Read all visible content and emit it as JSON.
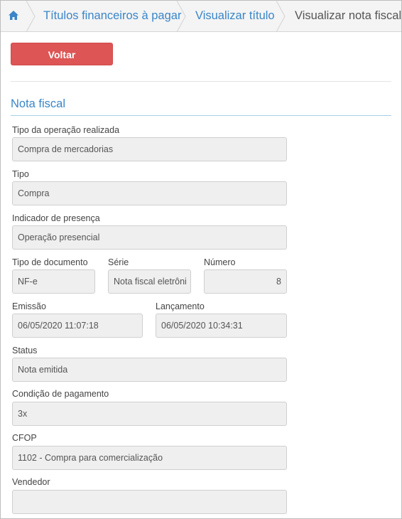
{
  "breadcrumb": {
    "items": [
      {
        "label": "Títulos financeiros à pagar"
      },
      {
        "label": "Visualizar título"
      },
      {
        "label": "Visualizar nota fiscal"
      }
    ]
  },
  "actions": {
    "back_label": "Voltar"
  },
  "section": {
    "title": "Nota fiscal"
  },
  "fields": {
    "tipo_operacao": {
      "label": "Tipo da operação realizada",
      "value": "Compra de mercadorias"
    },
    "tipo": {
      "label": "Tipo",
      "value": "Compra"
    },
    "indicador_presenca": {
      "label": "Indicador de presença",
      "value": "Operação presencial"
    },
    "tipo_documento": {
      "label": "Tipo de documento",
      "value": "NF-e"
    },
    "serie": {
      "label": "Série",
      "value": "Nota fiscal eletrôni"
    },
    "numero": {
      "label": "Número",
      "value": "8"
    },
    "emissao": {
      "label": "Emissão",
      "value": "06/05/2020 11:07:18"
    },
    "lancamento": {
      "label": "Lançamento",
      "value": "06/05/2020 10:34:31"
    },
    "status": {
      "label": "Status",
      "value": "Nota emitida"
    },
    "condicao_pagamento": {
      "label": "Condição de pagamento",
      "value": "3x"
    },
    "cfop": {
      "label": "CFOP",
      "value": "1102 - Compra para comercialização"
    },
    "vendedor": {
      "label": "Vendedor",
      "value": ""
    }
  },
  "colors": {
    "accent": "#3a86c8",
    "danger": "#dd5555"
  }
}
